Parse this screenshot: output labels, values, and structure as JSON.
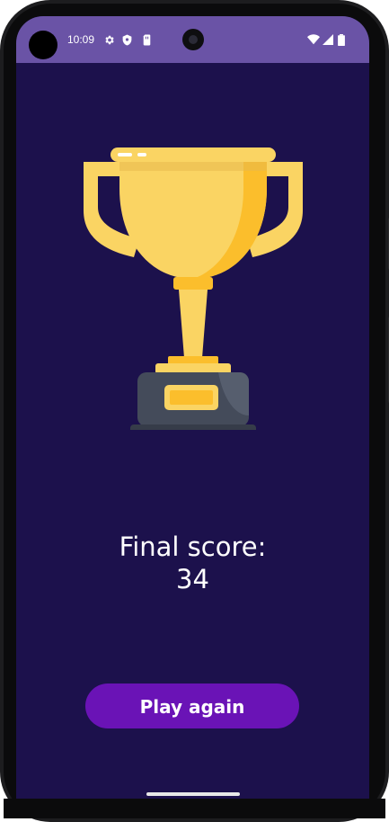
{
  "status_bar": {
    "time": "10:09",
    "icons_left": [
      "gear-icon",
      "shield-icon",
      "sim-card-icon"
    ],
    "icons_right": [
      "wifi-icon",
      "signal-icon",
      "battery-icon"
    ],
    "background_color": "#6a53a6"
  },
  "screen": {
    "background_color": "#1c114c",
    "illustration": "trophy-icon"
  },
  "result": {
    "label": "Final score:",
    "score": "34"
  },
  "actions": {
    "play_again_label": "Play again",
    "button_color": "#6a13b6"
  }
}
